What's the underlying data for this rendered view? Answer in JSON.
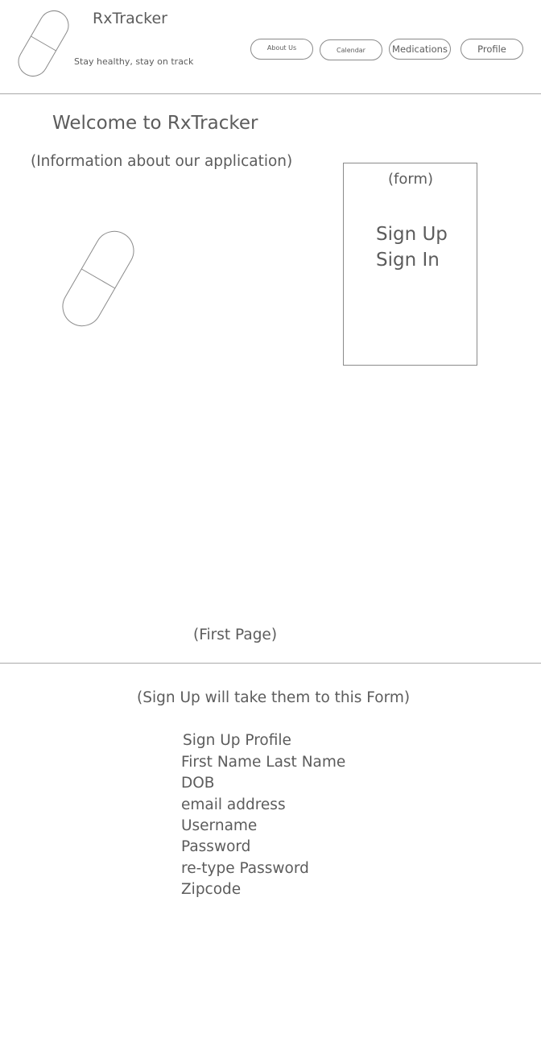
{
  "header": {
    "app_name": "RxTracker",
    "tagline": "Stay healthy, stay on track",
    "nav": {
      "about": "About Us",
      "calendar": "Calendar",
      "medications": "Medications",
      "profile": "Profile"
    }
  },
  "landing": {
    "welcome_title": "Welcome to RxTracker",
    "info_text": "(Information about our application)",
    "form_label": "(form)",
    "sign_up": "Sign Up",
    "sign_in": "Sign In",
    "page_caption": "(First Page)"
  },
  "signup_section": {
    "note": "(Sign Up will take them to this Form)",
    "title": "Sign Up Profile",
    "fields": [
      "First Name Last Name",
      "DOB",
      "email address",
      "Username",
      "Password",
      "re-type Password",
      "Zipcode"
    ]
  },
  "icons": {
    "logo": "pill-icon",
    "illustration": "pill-icon"
  },
  "colors": {
    "text": "#5c5c5c",
    "line": "#8a8a8a",
    "background": "#ffffff"
  }
}
